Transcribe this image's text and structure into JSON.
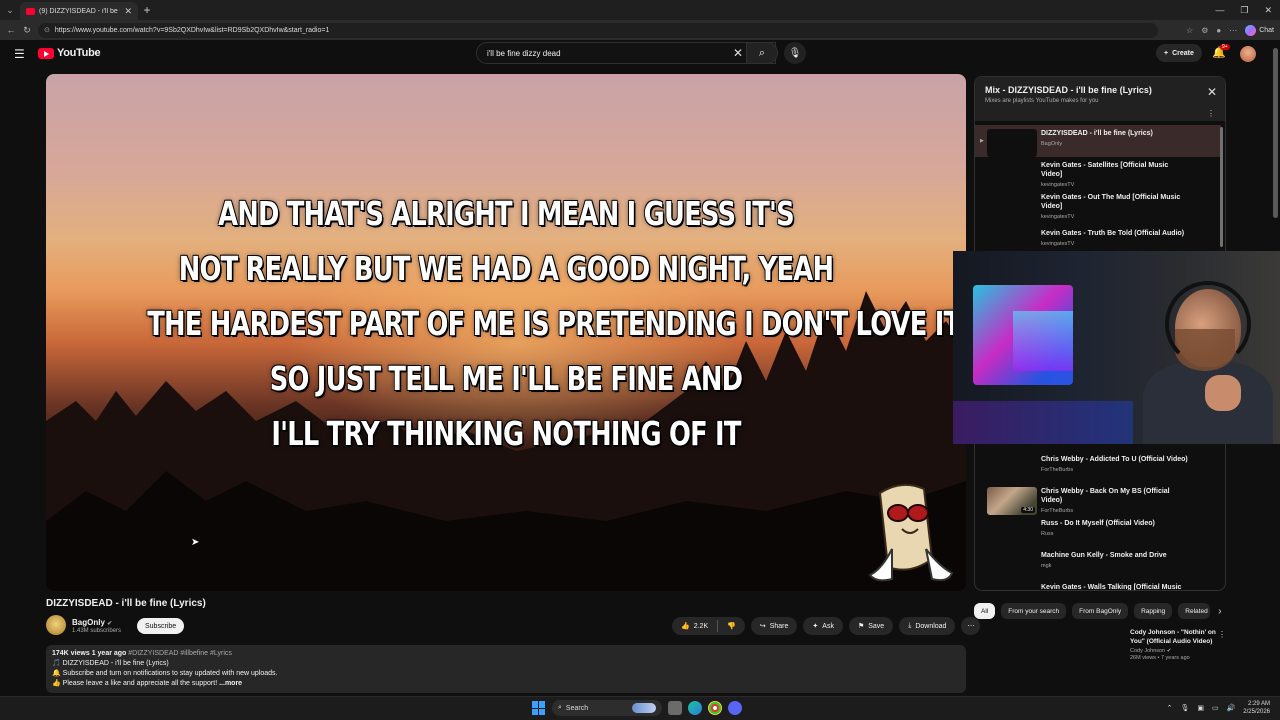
{
  "browser": {
    "tab_title": "(9) DIZZYISDEAD - i'll be fine",
    "url": "https://www.youtube.com/watch?v=9Sb2QXDhvIw&list=RD9Sb2QXDhvIw&start_radio=1",
    "chat_label": "Chat"
  },
  "header": {
    "logo_text": "YouTube",
    "search_value": "i'll be fine dizzy dead",
    "create_label": "Create",
    "notif_badge": "9+"
  },
  "player": {
    "lyrics": [
      "AND THAT'S ALRIGHT I MEAN I GUESS IT'S",
      "NOT REALLY BUT WE HAD A GOOD NIGHT, YEAH",
      "THE HARDEST PART OF ME IS PRETENDING I DON'T LOVE IT",
      "SO JUST TELL ME I'LL BE FINE AND",
      "I'LL TRY THINKING NOTHING OF IT"
    ]
  },
  "video": {
    "title": "DIZZYISDEAD - i'll be fine (Lyrics)",
    "channel": "BagOnly",
    "subscribers": "1.43M subscribers",
    "subscribe_label": "Subscribe",
    "likes": "2.2K",
    "share_label": "Share",
    "ask_label": "Ask",
    "save_label": "Save",
    "download_label": "Download",
    "description": {
      "views_date": "174K views  1 year ago",
      "hashtags": "#DIZZYISDEAD #illbefine #Lyrics",
      "line1": "🎵 DIZZYISDEAD - i'll be fine (Lyrics)",
      "line2": "🔔 Subscribe and turn on notifications to stay updated with new uploads.",
      "line3": "👍 Please leave a like and appreciate all the support!",
      "more": "...more"
    }
  },
  "mix": {
    "title": "Mix - DIZZYISDEAD - i'll be fine (Lyrics)",
    "subtitle": "Mixes are playlists YouTube makes for you",
    "items": [
      {
        "title": "DIZZYISDEAD - i'll be fine (Lyrics)",
        "channel": "BagOnly"
      },
      {
        "title": "Kevin Gates - Satellites [Official Music Video]",
        "channel": "kevingatesTV"
      },
      {
        "title": "Kevin Gates - Out The Mud [Official Music Video]",
        "channel": "kevingatesTV"
      },
      {
        "title": "Kevin Gates - Truth Be Told (Official Audio)",
        "channel": "kevingatesTV"
      },
      {
        "title": "Chris Webby - Addicted To U (Official Video)",
        "channel": "ForTheBurbs"
      },
      {
        "title": "Chris Webby - Back On My BS (Official Video)",
        "channel": "ForTheBurbs",
        "duration": "4:30"
      },
      {
        "title": "Russ - Do It Myself (Official Video)",
        "channel": "Russ"
      },
      {
        "title": "Machine Gun Kelly - Smoke and Drive",
        "channel": "mgk"
      },
      {
        "title": "Kevin Gates - Walls Talking [Official Music",
        "channel": ""
      }
    ]
  },
  "chips": [
    "All",
    "From your search",
    "From BagOnly",
    "Rapping",
    "Related"
  ],
  "recommendation": {
    "title": "Cody Johnson - \"Nothin' on You\" (Official Audio Video)",
    "channel": "Cody Johnson",
    "meta": "26M views • 7 years ago"
  },
  "taskbar": {
    "search_label": "Search",
    "time": "2:29 AM",
    "date": "2/25/2026"
  }
}
